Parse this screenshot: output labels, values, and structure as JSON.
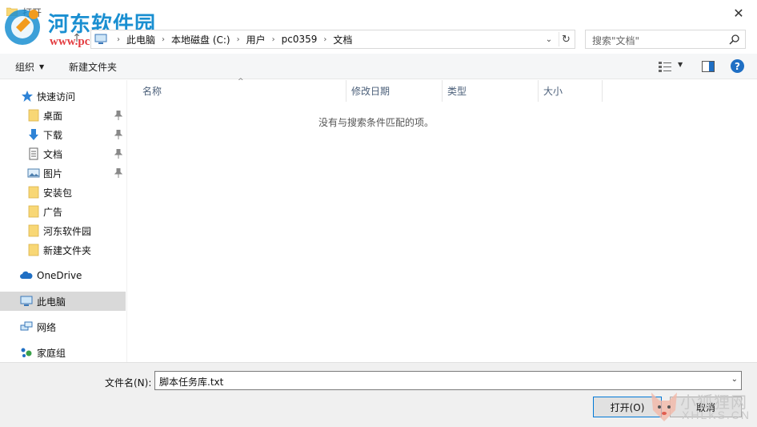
{
  "window": {
    "title": "打开",
    "close_glyph": "✕"
  },
  "watermark": {
    "site_name": "河东软件园",
    "site_url": "www.pc0359.cn",
    "corner_cn": "小狐狸网",
    "corner_en": "XHLKS.CN"
  },
  "address": {
    "crumbs": [
      "此电脑",
      "本地磁盘 (C:)",
      "用户",
      "pc0359",
      "文档"
    ],
    "separator": "›",
    "dropdown_glyph": "⌄",
    "refresh_glyph": "↻"
  },
  "search": {
    "placeholder": "搜索\"文档\""
  },
  "toolbar": {
    "organize_label": "组织",
    "new_folder_label": "新建文件夹"
  },
  "nav": {
    "quick_access": "快速访问",
    "items": [
      {
        "label": "桌面",
        "icon": "folder-icon",
        "pinned": true
      },
      {
        "label": "下载",
        "icon": "download-arrow-icon",
        "pinned": true
      },
      {
        "label": "文档",
        "icon": "document-icon",
        "pinned": true
      },
      {
        "label": "图片",
        "icon": "pictures-icon",
        "pinned": true
      },
      {
        "label": "安装包",
        "icon": "folder-icon",
        "pinned": false
      },
      {
        "label": "广告",
        "icon": "folder-icon",
        "pinned": false
      },
      {
        "label": "河东软件园",
        "icon": "folder-icon",
        "pinned": false
      },
      {
        "label": "新建文件夹",
        "icon": "folder-icon",
        "pinned": false
      }
    ],
    "onedrive": "OneDrive",
    "this_pc": "此电脑",
    "network": "网络",
    "homegroup": "家庭组",
    "selected": "此电脑"
  },
  "columns": {
    "name": "名称",
    "modified": "修改日期",
    "type": "类型",
    "size": "大小"
  },
  "file_list": {
    "empty_message": "没有与搜索条件匹配的项。"
  },
  "bottom": {
    "filename_label": "文件名(N):",
    "filename_value": "脚本任务库.txt",
    "open_button": "打开(O)",
    "cancel_button": "取消"
  },
  "colors": {
    "accent": "#0078d7",
    "folder": "#f8d775",
    "selection": "#d9d9d9",
    "header_text": "#4c607a"
  }
}
